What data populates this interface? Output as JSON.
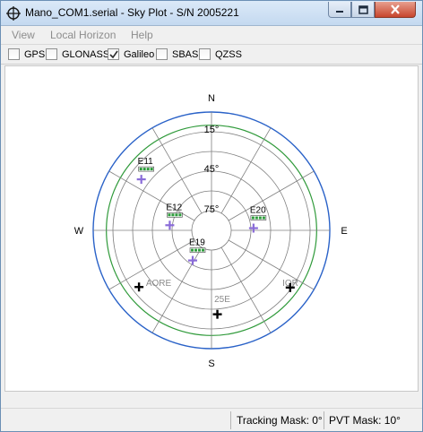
{
  "window": {
    "title": "Mano_COM1.serial - Sky Plot - S/N 2005221"
  },
  "menu": [
    "View",
    "Local Horizon",
    "Help"
  ],
  "filters": [
    {
      "label": "GPS",
      "checked": false
    },
    {
      "label": "GLONASS",
      "checked": false
    },
    {
      "label": "Galileo",
      "checked": true
    },
    {
      "label": "SBAS",
      "checked": false
    },
    {
      "label": "QZSS",
      "checked": false
    }
  ],
  "skyplot": {
    "directions": {
      "north": "N",
      "south": "S",
      "east": "E",
      "west": "W"
    },
    "elevation_labels": [
      "15°",
      "45°",
      "75°"
    ],
    "region_labels": [
      "AORE",
      "IOR",
      "25E"
    ],
    "satellites": [
      {
        "id": "E11",
        "azimuth": 306,
        "elevation": 24
      },
      {
        "id": "E12",
        "azimuth": 277,
        "elevation": 58
      },
      {
        "id": "E20",
        "azimuth": 87,
        "elevation": 58
      },
      {
        "id": "E19",
        "azimuth": 212,
        "elevation": 63
      }
    ],
    "sbas_markers": [
      {
        "azimuth": 232,
        "elevation": 20
      },
      {
        "azimuth": 176,
        "elevation": 26
      },
      {
        "azimuth": 126,
        "elevation": 16
      }
    ],
    "colors": {
      "outer_ring": "#2a62c8",
      "mask_ring": "#2f9a3a",
      "grid": "#808080",
      "satellite": "#8a6cd8",
      "sbas": "#000000",
      "signal_bars": "#2c9c3a"
    }
  },
  "status": {
    "tracking_mask": "Tracking Mask: 0°",
    "pvt_mask": "PVT Mask: 10°"
  }
}
